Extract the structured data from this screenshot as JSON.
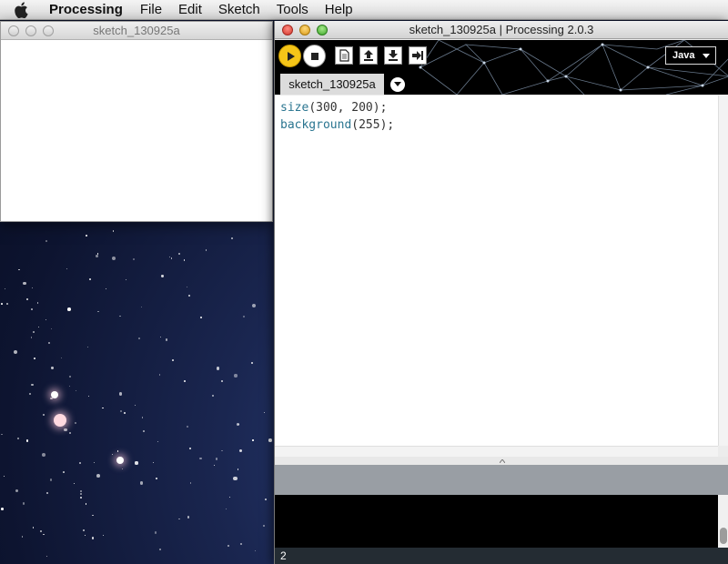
{
  "menubar": {
    "apple_icon": "apple-logo-icon",
    "app_name": "Processing",
    "items": [
      "File",
      "Edit",
      "Sketch",
      "Tools",
      "Help"
    ]
  },
  "sketch_window": {
    "title": "sketch_130925a",
    "background_color": "#ffffff"
  },
  "pde_window": {
    "title": "sketch_130925a | Processing 2.0.3",
    "toolbar": {
      "buttons": [
        "run-icon",
        "stop-icon",
        "new-icon",
        "open-icon",
        "save-icon",
        "export-icon"
      ],
      "mode": "Java"
    },
    "tab_label": "sketch_130925a",
    "code": {
      "line1": {
        "fn": "size",
        "args": "(300, 200);"
      },
      "line2": {
        "fn": "background",
        "args": "(255);"
      }
    },
    "line_number": "2"
  },
  "colors": {
    "run_button": "#f5c518",
    "keyword": "#2a7590",
    "status_bar": "#999ea4",
    "console": "#000000",
    "line_bar": "#242c33"
  }
}
